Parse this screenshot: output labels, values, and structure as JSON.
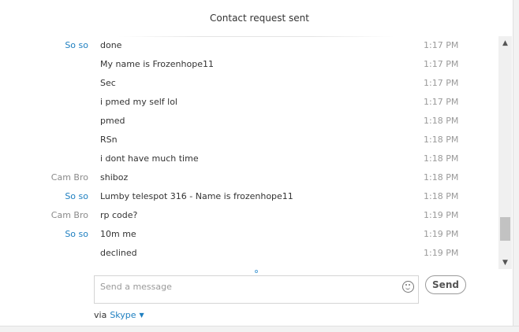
{
  "header": {
    "status": "Contact request sent"
  },
  "messages": [
    {
      "sender": "So so",
      "self": true,
      "text": "done",
      "time": "1:17 PM"
    },
    {
      "sender": "",
      "self": true,
      "text": "My name is Frozenhope11",
      "time": "1:17 PM"
    },
    {
      "sender": "",
      "self": true,
      "text": "Sec",
      "time": "1:17 PM"
    },
    {
      "sender": "",
      "self": true,
      "text": "i pmed my self lol",
      "time": "1:17 PM"
    },
    {
      "sender": "",
      "self": true,
      "text": "pmed",
      "time": "1:18 PM"
    },
    {
      "sender": "",
      "self": true,
      "text": "RSn",
      "time": "1:18 PM"
    },
    {
      "sender": "",
      "self": true,
      "text": "i dont have much time",
      "time": "1:18 PM"
    },
    {
      "sender": "Cam Bro",
      "self": false,
      "text": "shiboz",
      "time": "1:18 PM"
    },
    {
      "sender": "So so",
      "self": true,
      "text": "Lumby telespot 316 - Name is frozenhope11",
      "time": "1:18 PM"
    },
    {
      "sender": "Cam Bro",
      "self": false,
      "text": "rp code?",
      "time": "1:19 PM"
    },
    {
      "sender": "So so",
      "self": true,
      "text": "10m me",
      "time": "1:19 PM"
    },
    {
      "sender": "",
      "self": true,
      "text": "declined",
      "time": "1:19 PM"
    }
  ],
  "compose": {
    "placeholder": "Send a message",
    "send_label": "Send",
    "emoji_icon": "emoticon-icon"
  },
  "footer": {
    "via_label": "via",
    "service": "Skype"
  },
  "scrollbar": {
    "position": 0.92
  }
}
